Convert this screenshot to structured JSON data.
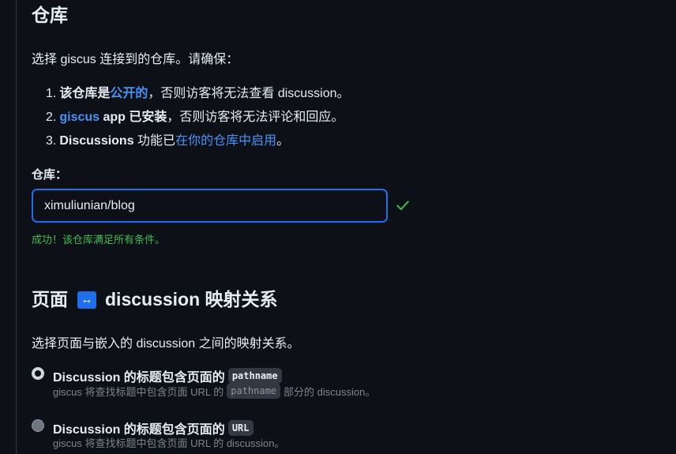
{
  "repository": {
    "title": "仓库",
    "intro": "选择 giscus 连接到的仓库。请确保：",
    "requirements": [
      {
        "num": "1.",
        "bold": "该仓库是",
        "link": "公开的",
        "rest": "，否则访客将无法查看 discussion。"
      },
      {
        "num": "2.",
        "link": "giscus",
        "bold": " app 已安装",
        "rest": "，否则访客将无法评论和回应。"
      },
      {
        "num": "3.",
        "bold": "Discussions",
        "text": " 功能已",
        "link": "在你的仓库中启用",
        "rest": "。"
      }
    ],
    "field_label": "仓库：",
    "input_value": "ximuliunian/blog",
    "success_message": "成功！该仓库满足所有条件。"
  },
  "mapping": {
    "title_prefix": "页面",
    "title_arrow": "↔",
    "title_suffix": "discussion 映射关系",
    "description": "选择页面与嵌入的 discussion 之间的映射关系。",
    "options": [
      {
        "label": "Discussion 的标题包含页面的",
        "code": "pathname",
        "desc_before": "giscus 将查找标题中包含页面 URL 的",
        "desc_code": "pathname",
        "desc_after": "部分的 discussion。",
        "checked": true
      },
      {
        "label": "Discussion 的标题包含页面的",
        "code": "URL",
        "desc_before": "giscus 将查找标题中包含页面 URL 的 discussion。",
        "checked": false
      }
    ]
  },
  "colors": {
    "background": "#0d1117",
    "accent": "#4493f8",
    "success": "#3fb950",
    "input_border": "#1f6feb"
  },
  "icons": {
    "check": "check-icon",
    "arrow": "left-right-arrow-icon"
  }
}
